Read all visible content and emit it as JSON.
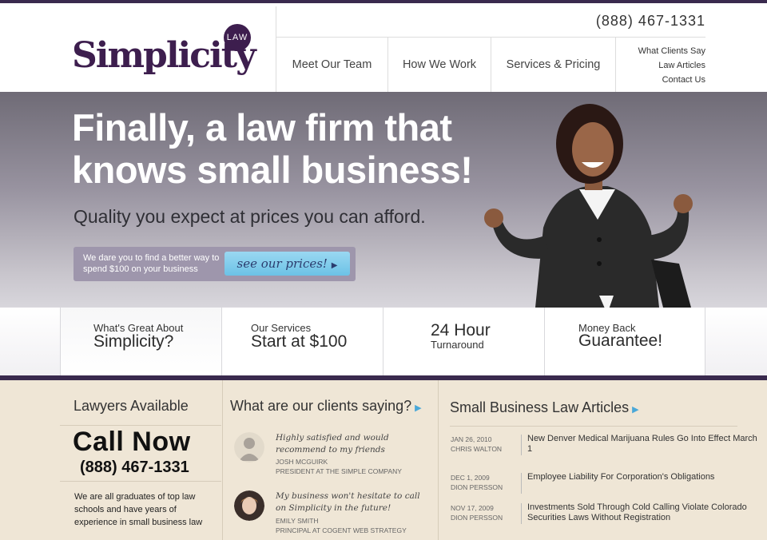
{
  "header": {
    "logo_text": "Simplicity",
    "logo_badge": "LAW",
    "phone": "(888) 467-1331",
    "nav": [
      "Meet Our Team",
      "How We Work",
      "Services & Pricing"
    ],
    "secondary_nav": [
      "What Clients Say",
      "Law Articles",
      "Contact Us"
    ]
  },
  "hero": {
    "headline_line1": "Finally, a law firm that",
    "headline_line2": "knows small business!",
    "subheadline": "Quality you expect at prices you can afford.",
    "dare_text": "We dare you to find a better way to spend $100 on your business",
    "prices_button": "see our prices!"
  },
  "features": [
    {
      "small": "What's Great About",
      "big": "Simplicity?"
    },
    {
      "small": "Our Services",
      "big": "Start at $100"
    },
    {
      "big": "24 Hour",
      "small": "Turnaround"
    },
    {
      "small": "Money Back",
      "big": "Guarantee!"
    }
  ],
  "lawyers": {
    "title": "Lawyers Available",
    "call": "Call Now",
    "phone": "(888) 467-1331",
    "text": "We are all graduates of top law schools and have years of experience in small business law"
  },
  "testimonials": {
    "title": "What are our clients saying?",
    "items": [
      {
        "quote": "Highly satisfied and would recommend to my friends",
        "name": "Josh McGuirk",
        "role": "President at The Simple Company"
      },
      {
        "quote": "My business won't hesitate to call on Simplicity in the future!",
        "name": "Emily Smith",
        "role": "Principal at Cogent Web Strategy"
      }
    ]
  },
  "articles": {
    "title": "Small Business Law Articles",
    "items": [
      {
        "date": "JAN 26, 2010",
        "author": "CHRIS WALTON",
        "title": "New Denver Medical Marijuana Rules Go Into Effect March 1"
      },
      {
        "date": "DEC 1, 2009",
        "author": "DION PERSSON",
        "title": "Employee Liability For Corporation's Obligations"
      },
      {
        "date": "NOV 17, 2009",
        "author": "DION PERSSON",
        "title": "Investments Sold Through Cold Calling Violate Colorado Securities Laws Without Registration"
      }
    ]
  }
}
